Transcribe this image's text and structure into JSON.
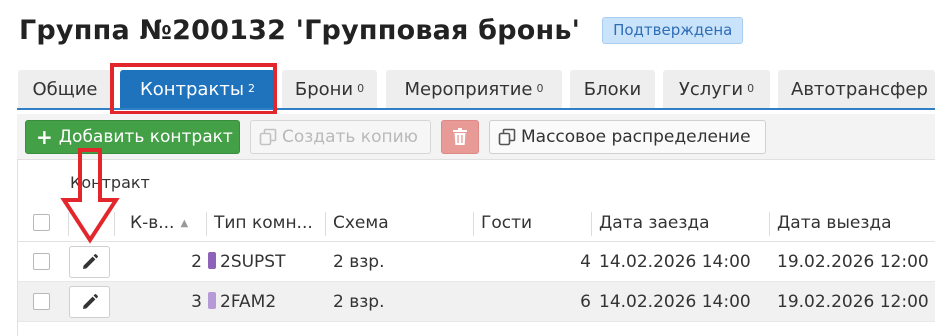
{
  "header": {
    "title": "Группа №200132 'Групповая бронь'",
    "status": "Подтверждена"
  },
  "tabs": [
    {
      "label": "Общие",
      "count": ""
    },
    {
      "label": "Контракты",
      "count": "2"
    },
    {
      "label": "Брони",
      "count": "0"
    },
    {
      "label": "Мероприятие",
      "count": "0"
    },
    {
      "label": "Блоки",
      "count": ""
    },
    {
      "label": "Услуги",
      "count": "0"
    },
    {
      "label": "Автотрансфер",
      "count": ""
    }
  ],
  "toolbar": {
    "add_label": "Добавить контракт",
    "copy_label": "Создать копию",
    "distribute_label": "Массовое распределение"
  },
  "grid": {
    "group_header": "Контракт",
    "columns": {
      "qty": "К-в...",
      "room_type": "Тип комн...",
      "scheme": "Схема",
      "guests": "Гости",
      "checkin": "Дата заезда",
      "checkout": "Дата выезда"
    },
    "rows": [
      {
        "qty": "2",
        "room_type": "2SUPST",
        "room_color": "#8e62b8",
        "scheme": "2 взр.",
        "guests": "4",
        "checkin": "14.02.2026 14:00",
        "checkout": "19.02.2026 12:00"
      },
      {
        "qty": "3",
        "room_type": "2FAM2",
        "room_color": "#b69ad8",
        "scheme": "2 взр.",
        "guests": "6",
        "checkin": "14.02.2026 14:00",
        "checkout": "19.02.2026 12:00"
      }
    ]
  },
  "icons": {
    "add": "plus-icon",
    "copy": "copy-icon",
    "delete": "trash-icon",
    "distribute": "copy-icon",
    "edit": "pencil-icon",
    "sort": "sort-up-icon"
  },
  "colors": {
    "accent": "#1f73bd",
    "success": "#43a047",
    "danger": "#e89a97",
    "highlight": "#e3262c"
  }
}
